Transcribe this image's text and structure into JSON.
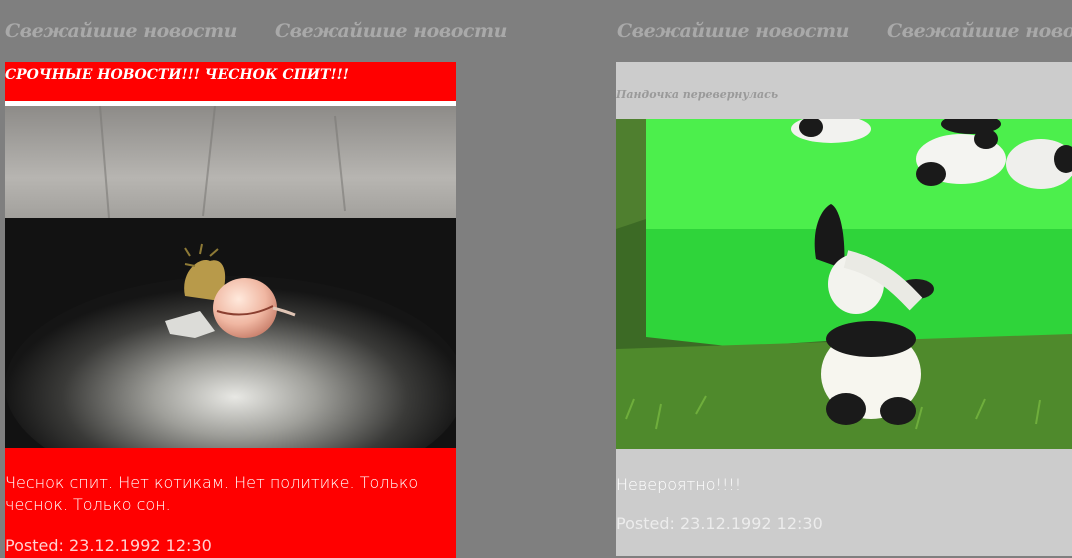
{
  "headings": [
    "Свежайшие новости",
    "Свежайшие новости",
    "Свежайшие новости",
    "Свежайшие новости"
  ],
  "posts": [
    {
      "title": "СРОЧНЫЕ НОВОСТИ!!! ЧЕСНОК СПИТ!!!",
      "image_icon": "garlic-photo",
      "body": "Чеснок спит. Нет котикам. Нет политике. Только чеснок. Только сон.",
      "posted": "Posted: 23.12.1992 12:30",
      "background": "#ff0000"
    },
    {
      "title": "Пандочка перевернулась",
      "image_icon": "panda-photo",
      "body": "Невероятно!!!!",
      "posted": "Posted: 23.12.1992 12:30",
      "background": "#cccccc"
    }
  ]
}
